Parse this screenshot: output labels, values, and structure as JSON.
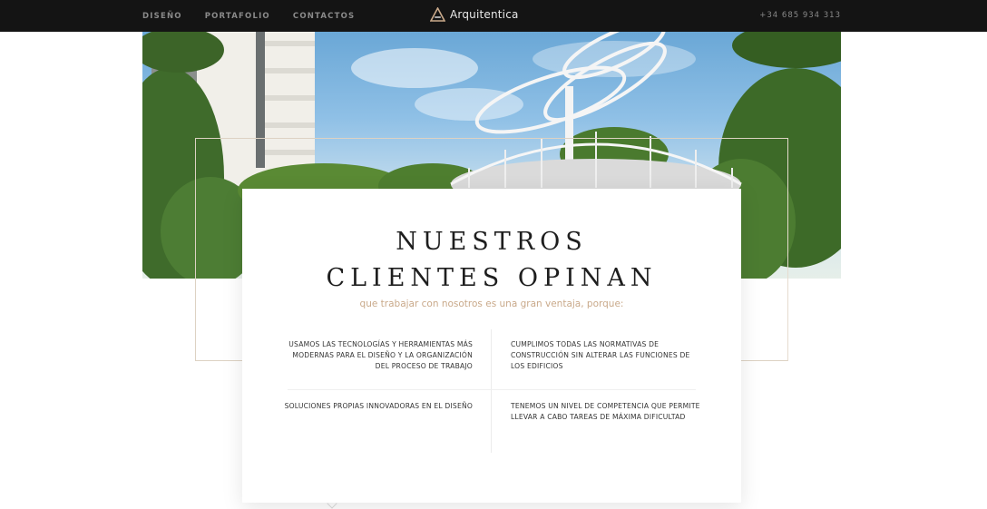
{
  "header": {
    "nav": [
      "DISEÑO",
      "PORTAFOLIO",
      "CONTACTOS"
    ],
    "logo_text": "Arquitentica",
    "phone": "+34 685 934 313"
  },
  "section": {
    "title_line1": "Nuestros",
    "title_line2": "clientes opinan",
    "subtitle": "que trabajar con nosotros es una gran ventaja, porque:",
    "features": [
      "USAMOS LAS TECNOLOGÍAS Y HERRAMIENTAS MÁS MODERNAS PARA EL DISEÑO Y LA ORGANIZACIÓN DEL PROCESO DE TRABAJO",
      "CUMPLIMOS TODAS LAS NORMATIVAS DE CONSTRUCCIÓN SIN ALTERAR LAS FUNCIONES DE LOS EDIFICIOS",
      "SOLUCIONES PROPIAS INNOVADORAS EN EL DISEÑO",
      "TENEMOS UN NIVEL DE COMPETENCIA QUE PERMITE LLEVAR A CABO TAREAS DE MÁXIMA DIFICULTAD"
    ]
  },
  "colors": {
    "topbar": "#141414",
    "accent": "#c9a98a",
    "frame": "#ddd2c3"
  },
  "icons": {
    "logo": "triangle-a-logo-icon"
  }
}
